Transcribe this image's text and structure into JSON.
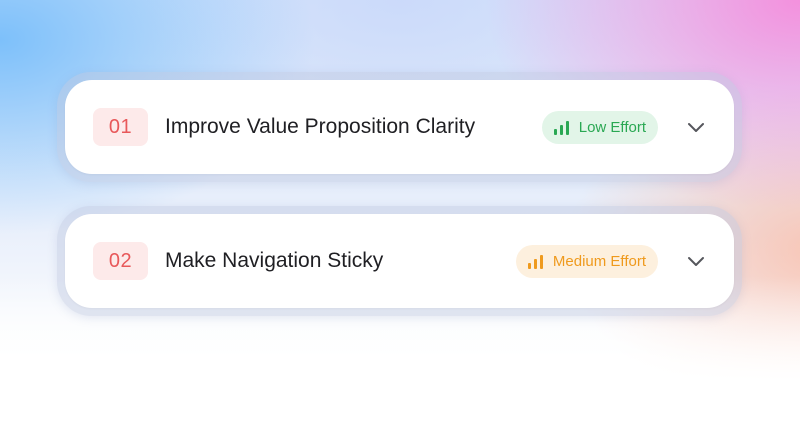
{
  "items": [
    {
      "number": "01",
      "title": "Improve Value Proposition Clarity",
      "effort": {
        "label": "Low Effort",
        "level": "low",
        "color": "#2aa853",
        "background": "#e2f5e8",
        "icon": "signal-bars-icon"
      },
      "toggle_icon": "chevron-down-icon"
    },
    {
      "number": "02",
      "title": "Make Navigation Sticky",
      "effort": {
        "label": "Medium Effort",
        "level": "medium",
        "color": "#ef9a1d",
        "background": "#fdf0de",
        "icon": "signal-bars-icon"
      },
      "toggle_icon": "chevron-down-icon"
    }
  ],
  "colors": {
    "number_text": "#e8585a",
    "number_bg": "#fdeaea",
    "title_text": "#1f1f23",
    "chevron": "#55565c"
  }
}
